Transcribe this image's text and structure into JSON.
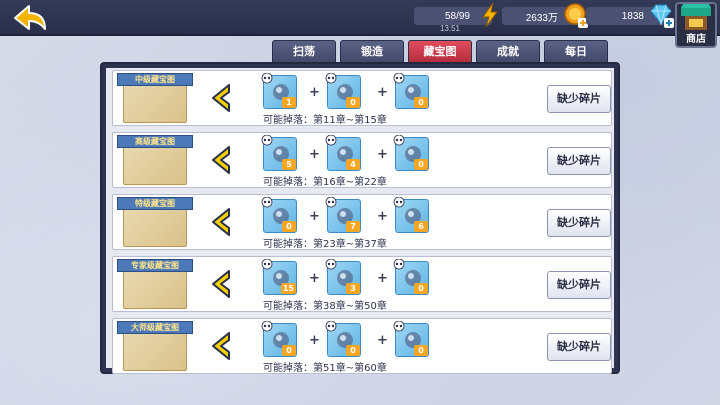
{
  "header": {
    "stamina": "58/99",
    "stamina_timer": "13:51",
    "gold": "2633万",
    "gems": "1838",
    "shop_label": "商店"
  },
  "tabs": [
    {
      "label": "扫荡",
      "active": false
    },
    {
      "label": "锻造",
      "active": false
    },
    {
      "label": "藏宝图",
      "active": true
    },
    {
      "label": "成就",
      "active": false
    },
    {
      "label": "每日",
      "active": false
    }
  ],
  "drop_prefix": "可能掉落：",
  "missing_label": "缺少碎片",
  "rows": [
    {
      "map_name": "中级藏宝图",
      "drop_range": "第11章~第15章",
      "items": [
        {
          "count": "1",
          "icon": "barrel-icon"
        },
        {
          "count": "0",
          "icon": "spyglass-icon"
        },
        {
          "count": "0",
          "icon": "goblet-icon"
        }
      ]
    },
    {
      "map_name": "高级藏宝图",
      "drop_range": "第16章~第22章",
      "items": [
        {
          "count": "5",
          "icon": "telescope-icon"
        },
        {
          "count": "4",
          "icon": "sword-icon"
        },
        {
          "count": "0",
          "icon": "hook-icon"
        }
      ]
    },
    {
      "map_name": "特级藏宝图",
      "drop_range": "第23章~第37章",
      "items": [
        {
          "count": "0",
          "icon": "key-icon"
        },
        {
          "count": "7",
          "icon": "pirate-hat-icon"
        },
        {
          "count": "6",
          "icon": "bomb-icon"
        }
      ]
    },
    {
      "map_name": "专家级藏宝图",
      "drop_range": "第38章~第50章",
      "items": [
        {
          "count": "15",
          "icon": "magnifier-icon"
        },
        {
          "count": "3",
          "icon": "ring-icon"
        },
        {
          "count": "0",
          "icon": "orb-icon"
        }
      ]
    },
    {
      "map_name": "大师级藏宝图",
      "drop_range": "第51章~第60章",
      "items": [
        {
          "count": "0",
          "icon": "card-icon"
        },
        {
          "count": "0",
          "icon": "anchor-icon"
        },
        {
          "count": "0",
          "icon": "whale-icon"
        }
      ]
    }
  ],
  "colors": {
    "topbar": "#2a2f4a",
    "active_tab": "#d23c4e",
    "item_bg": "#7ec6ee",
    "count_badge": "#f5a623",
    "arrow": "#f4d000"
  }
}
